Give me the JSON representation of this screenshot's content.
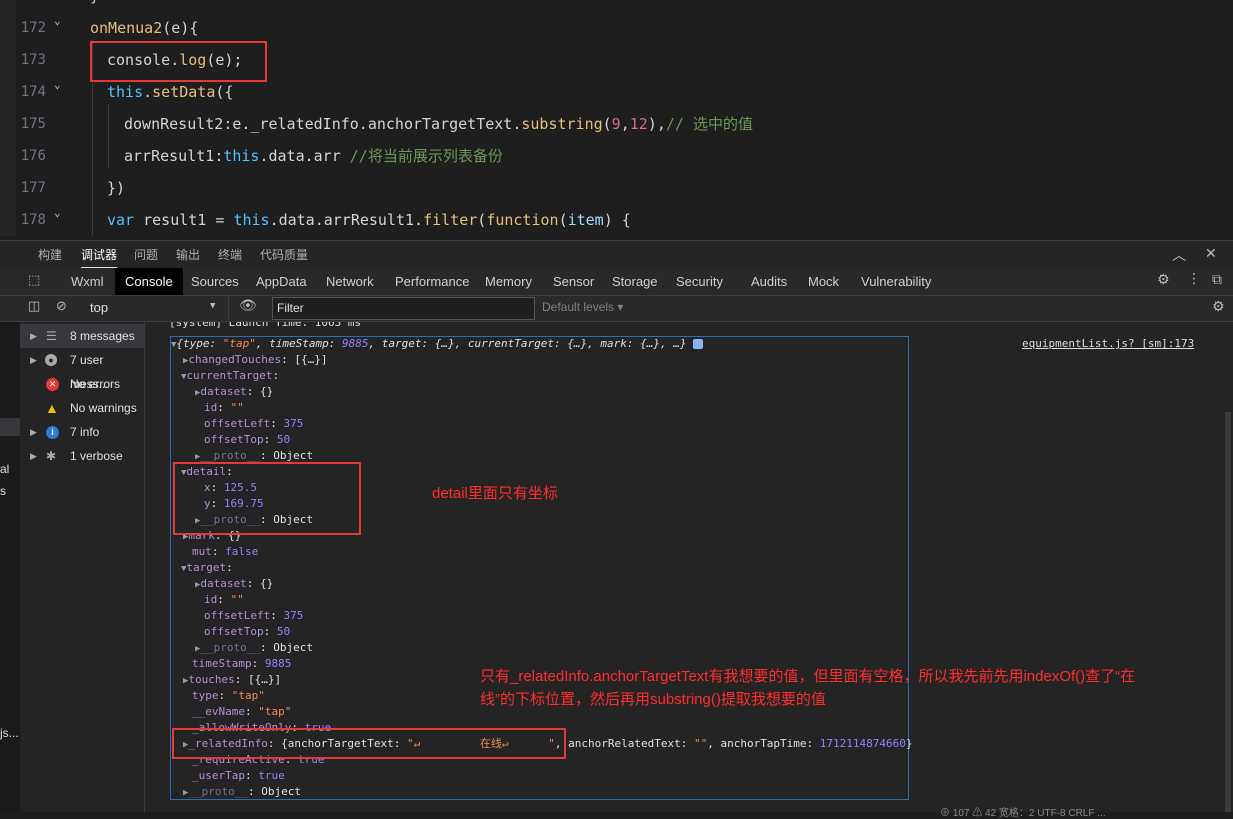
{
  "editor": {
    "lines": [
      {
        "num": "172",
        "fold": true
      },
      {
        "num": "173",
        "fold": false
      },
      {
        "num": "174",
        "fold": true
      },
      {
        "num": "175",
        "fold": false
      },
      {
        "num": "176",
        "fold": false
      },
      {
        "num": "177",
        "fold": false
      },
      {
        "num": "178",
        "fold": true
      }
    ],
    "code": {
      "l0a": "}",
      "l172a": "onMenua2",
      "l172b": "(e){",
      "l173a": "console.",
      "l173b": "log",
      "l173c": "(e);",
      "l174a": "this",
      "l174b": ".",
      "l174c": "setData",
      "l174d": "({",
      "l175a": "downResult2",
      "l175b": ":e._relatedInfo.anchorTargetText.",
      "l175c": "substring",
      "l175d": "(",
      "l175e": "9",
      "l175f": ",",
      "l175g": "12",
      "l175h": "),",
      "l175i": "// 选中的值",
      "l176a": "arrResult1",
      "l176b": ":",
      "l176c": "this",
      "l176d": ".data.arr ",
      "l176e": "//将当前展示列表备份",
      "l177a": "})",
      "l178a": "var",
      "l178b": " result1 = ",
      "l178c": "this",
      "l178d": ".data.arrResult1.",
      "l178e": "filter",
      "l178f": "(",
      "l178g": "function",
      "l178h": "(",
      "l178i": "item",
      "l178j": ") {"
    }
  },
  "panel_tabs": [
    "构建",
    "调试器",
    "问题",
    "输出",
    "终端",
    "代码质量"
  ],
  "devtools_tabs": [
    "Wxml",
    "Console",
    "Sources",
    "AppData",
    "Network",
    "Performance",
    "Memory",
    "Sensor",
    "Storage",
    "Security",
    "Audits",
    "Mock",
    "Vulnerability"
  ],
  "filter": {
    "context": "top",
    "placeholder": "Filter",
    "levels": "Default levels"
  },
  "sidebar": [
    {
      "label": "8 messages"
    },
    {
      "label": "7 user mess..."
    },
    {
      "label": "No errors"
    },
    {
      "label": "No warnings"
    },
    {
      "label": "7 info"
    },
    {
      "label": "1 verbose"
    }
  ],
  "left_strip": [
    "al",
    "s",
    "js..."
  ],
  "console": {
    "system_line": "[system] Launch Time: 1063 ms",
    "source_link": "equipmentList.js? [sm]:173",
    "summary": {
      "type_key": "type",
      "type_val": "\"tap\"",
      "ts_key": "timeStamp",
      "ts_val": "9885",
      "target_key": "target",
      "ct_key": "currentTarget",
      "mark_key": "mark",
      "obj": "{…}"
    },
    "changedTouches": {
      "key": "changedTouches",
      "val": "[{…}]"
    },
    "currentTarget": {
      "key": "currentTarget"
    },
    "dataset": {
      "key": "dataset",
      "val": "{}"
    },
    "id": {
      "key": "id",
      "val": "\"\""
    },
    "offsetLeft": {
      "key": "offsetLeft",
      "val": "375"
    },
    "offsetTop": {
      "key": "offsetTop",
      "val": "50"
    },
    "proto": {
      "key": "__proto__",
      "val": "Object"
    },
    "detail": {
      "key": "detail",
      "x_key": "x",
      "x_val": "125.5",
      "y_key": "y",
      "y_val": "169.75"
    },
    "mark": {
      "key": "mark",
      "val": "{}"
    },
    "mut": {
      "key": "mut",
      "val": "false"
    },
    "target": {
      "key": "target"
    },
    "timeStamp": {
      "key": "timeStamp",
      "val": "9885"
    },
    "touches": {
      "key": "touches",
      "val": "[{…}]"
    },
    "type": {
      "key": "type",
      "val": "\"tap\""
    },
    "evName": {
      "key": "__evName",
      "val": "\"tap\""
    },
    "allowWriteOnly": {
      "key": "_allowWriteOnly",
      "val": "true"
    },
    "relatedInfo": {
      "key": "_relatedInfo",
      "att_key": "anchorTargetText",
      "att_val_open": "\"↵",
      "att_val_mid": "在线↵",
      "att_val_close": "\"",
      "arr_key": "anchorRelatedText",
      "arr_val": "\"\"",
      "atime_key": "anchorTapTime",
      "atime_val": "1712114874660"
    },
    "requireActive": {
      "key": "_requireActive",
      "val": "true"
    },
    "userTap": {
      "key": "_userTap",
      "val": "true"
    }
  },
  "annotations": {
    "detail_note": "detail里面只有坐标",
    "related_note_1": "只有_relatedInfo.anchorTargetText有我想要的值，但里面有空格，所以我先前先用indexOf()查了“在",
    "related_note_2": "线”的下标位置，然后再用substring()提取我想要的值"
  },
  "status_bar": "⊕ 107   ⚠ 42   宽格：2   UTF-8   CRLF   ..."
}
